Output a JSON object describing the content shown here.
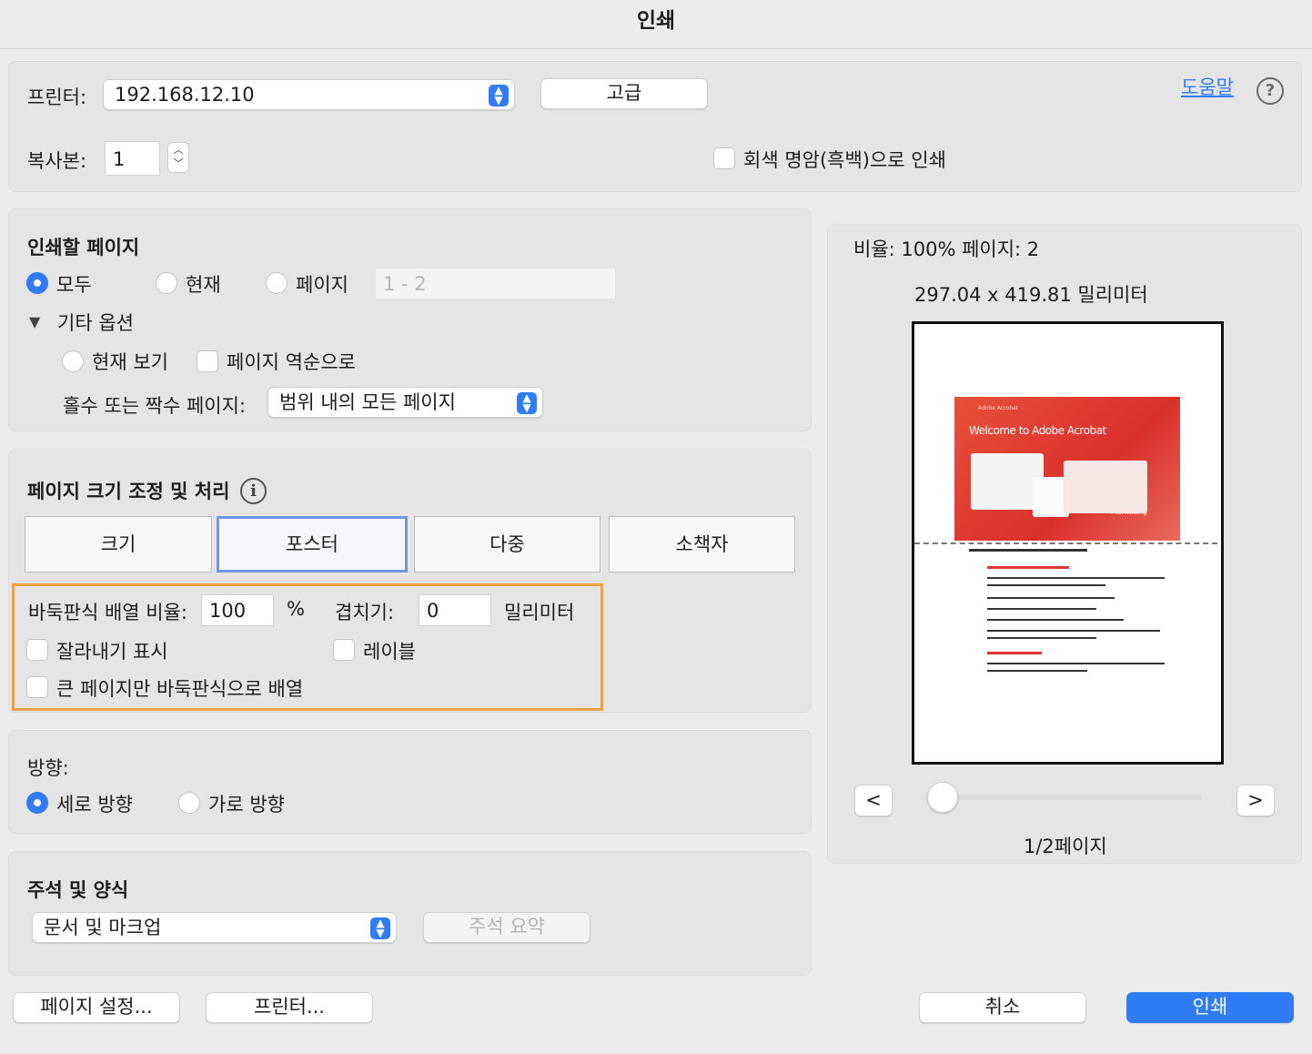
{
  "window": {
    "title": "인쇄"
  },
  "printer": {
    "label": "프린터:",
    "selected": "192.168.12.10",
    "advanced_button": "고급",
    "help_link": "도움말",
    "help_icon": "question-circle-icon"
  },
  "copies": {
    "label": "복사본:",
    "value": "1",
    "grayscale_label": "회색 명암(흑백)으로 인쇄"
  },
  "pages_to_print": {
    "title": "인쇄할 페이지",
    "options": [
      "모두",
      "현재",
      "페이지"
    ],
    "selected": "모두",
    "range_placeholder": "1 - 2",
    "more_options_label": "기타 옵션",
    "current_view_label": "현재 보기",
    "reverse_label": "페이지 역순으로",
    "odd_even_label": "홀수 또는 짝수 페이지:",
    "odd_even_selected": "범위 내의 모든 페이지"
  },
  "page_sizing": {
    "title": "페이지 크기 조정 및 처리",
    "tabs": [
      "크기",
      "포스터",
      "다중",
      "소책자"
    ],
    "active_tab": "포스터",
    "tile_scale_label": "바둑판식 배열 비율:",
    "tile_scale_value": "100",
    "tile_scale_unit": "%",
    "overlap_label": "겹치기:",
    "overlap_value": "0",
    "overlap_unit": "밀리미터",
    "cut_marks_label": "잘라내기 표시",
    "labels_label": "레이블",
    "tile_large_only_label": "큰 페이지만 바둑판식으로 배열",
    "highlight_color": "#f0a040"
  },
  "orientation": {
    "title": "방향:",
    "options": [
      "세로 방향",
      "가로 방향"
    ],
    "selected": "세로 방향"
  },
  "comments_forms": {
    "title": "주석 및 양식",
    "selected": "문서 및 마크업",
    "summarize_button": "주석 요약"
  },
  "preview": {
    "scale_text": "비율: 100% 페이지: 2",
    "dimensions": "297.04 x 419.81 밀리미터",
    "prev_button": "<",
    "next_button": ">",
    "slider_value": 0,
    "page_indicator": "1/2페이지",
    "thumb_banner_text": "Welcome to Adobe Acrobat",
    "thumb_brand_text": "Adobe Acrobat",
    "thumb_tag_text": "Marketing"
  },
  "footer": {
    "page_setup_button": "페이지 설정...",
    "printer_button": "프린터...",
    "cancel_button": "취소",
    "print_button": "인쇄"
  },
  "colors": {
    "accent": "#2f7cf6",
    "tab_focus": "#6f97e8"
  }
}
